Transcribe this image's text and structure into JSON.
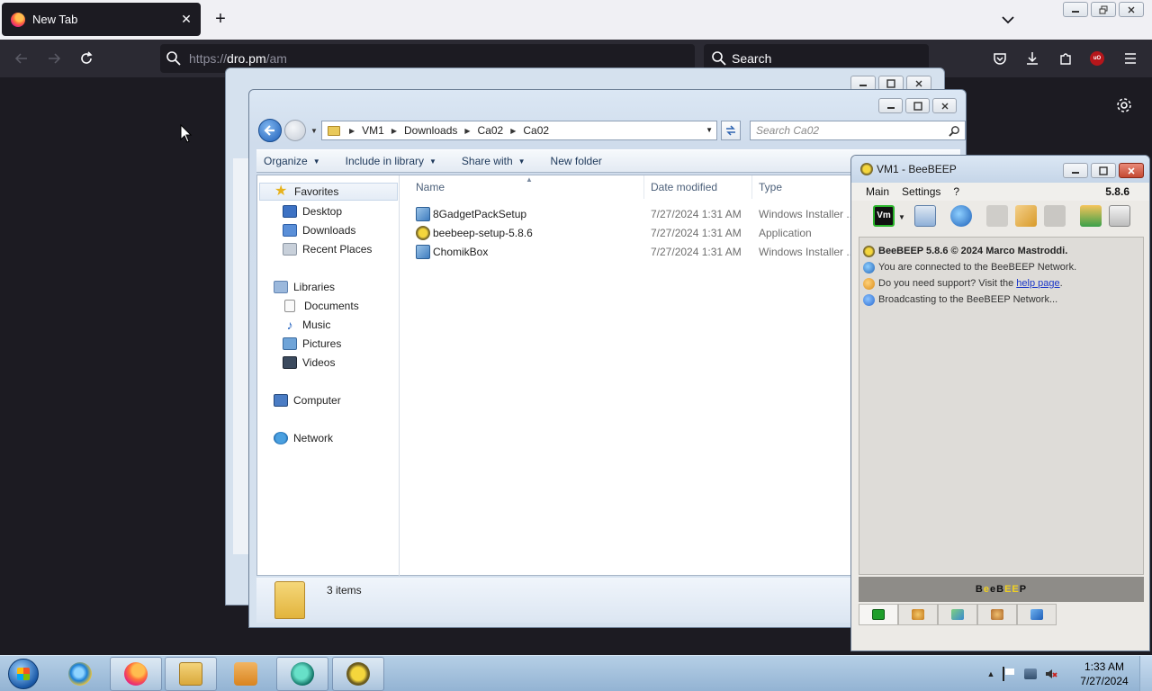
{
  "browser": {
    "tab_title": "New Tab",
    "url_prefix": "https://",
    "url_host": "dro.pm",
    "url_path": "/am",
    "search_placeholder": "Search"
  },
  "explorer": {
    "breadcrumb": [
      "VM1",
      "Downloads",
      "Ca02",
      "Ca02"
    ],
    "search_placeholder": "Search Ca02",
    "toolbar": {
      "organize": "Organize",
      "include_in_library": "Include in library",
      "share_with": "Share with",
      "new_folder": "New folder"
    },
    "nav": {
      "favorites": "Favorites",
      "desktop": "Desktop",
      "downloads": "Downloads",
      "recent_places": "Recent Places",
      "libraries": "Libraries",
      "documents": "Documents",
      "music": "Music",
      "pictures": "Pictures",
      "videos": "Videos",
      "computer": "Computer",
      "network": "Network"
    },
    "columns": {
      "name": "Name",
      "date_modified": "Date modified",
      "type": "Type"
    },
    "files": [
      {
        "name": "8GadgetPackSetup",
        "date": "7/27/2024 1:31 AM",
        "type": "Windows Installer ..."
      },
      {
        "name": "beebeep-setup-5.8.6",
        "date": "7/27/2024 1:31 AM",
        "type": "Application"
      },
      {
        "name": "ChomikBox",
        "date": "7/27/2024 1:31 AM",
        "type": "Windows Installer ..."
      }
    ],
    "status": "3 items"
  },
  "beebeep": {
    "title": "VM1 - BeeBEEP",
    "menu": {
      "main": "Main",
      "settings": "Settings",
      "help": "?"
    },
    "version": "5.8.6",
    "vm_badge": "Vm",
    "messages": {
      "header": "BeeBEEP 5.8.6 © 2024 Marco Mastroddi.",
      "connected": "You are connected to the BeeBEEP Network.",
      "support_prefix": "Do you need support? Visit the ",
      "support_link": "help page",
      "support_suffix": ".",
      "broadcasting": "Broadcasting to the BeeBEEP Network..."
    },
    "logo_letters": [
      "B",
      "e",
      "e",
      "B",
      "E",
      "E",
      "P"
    ]
  },
  "taskbar": {
    "time": "1:33 AM",
    "date": "7/27/2024"
  },
  "colors": {
    "firefox_dark": "#1c1b22",
    "firefox_toolbar": "#2b2a33",
    "win7_taskbar": "#a3bfdb",
    "link_blue": "#1a36c8"
  }
}
